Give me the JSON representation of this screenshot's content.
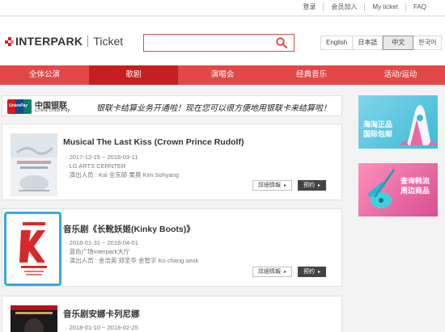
{
  "util_links": [
    "登录",
    "会员加入",
    "My ticket",
    "FAQ"
  ],
  "logo": {
    "brand": "INTERPARK",
    "product": "Ticket"
  },
  "search": {
    "placeholder": ""
  },
  "languages": [
    "English",
    "日本語",
    "中文",
    "한국어"
  ],
  "active_language": "中文",
  "nav": [
    "全体公演",
    "歌剧",
    "演唱会",
    "经典音乐",
    "活动/运动"
  ],
  "active_nav": "歌剧",
  "unionpay": {
    "name": "中国银联",
    "name_en": "China UnionPay",
    "card_label": "UnionPay",
    "message": "银联卡结算业务开通啦！现在您可以很方便地用银联卡来结算啦！"
  },
  "shows": [
    {
      "title": "Musical The Last Kiss (Crown Prince Rudolf)",
      "date": "2017-12-15 ~ 2018-03-11",
      "venue": "LG ARTS CERNTER",
      "cast": "演出人员 : Kai 全东硕 栗莫 Kim Sohyang",
      "detail_btn": "詳細情報",
      "book_btn": "预约"
    },
    {
      "title": "音乐剧《长靴妖姬(Kinky Boots)》",
      "date": "2018-01-31 ~ 2018-04-01",
      "venue": "蓝色广场Interpark大厅",
      "cast": "演出人员 : 金浩英 郑圣华 金智宇 Ko chang seok",
      "detail_btn": "詳細情報",
      "book_btn": "预约"
    },
    {
      "title": "音乐剧安娜卡列尼娜",
      "date": "2018-01-10 ~ 2018-02-25"
    }
  ],
  "ads": [
    {
      "line1": "海淘正品",
      "line2": "国际包邮"
    },
    {
      "line1": "查询韩流",
      "line2": "周边商品"
    }
  ],
  "colors": {
    "accent_red": "#e34848",
    "active_red": "#c61f1f",
    "selection_blue": "#3aa7e0"
  }
}
